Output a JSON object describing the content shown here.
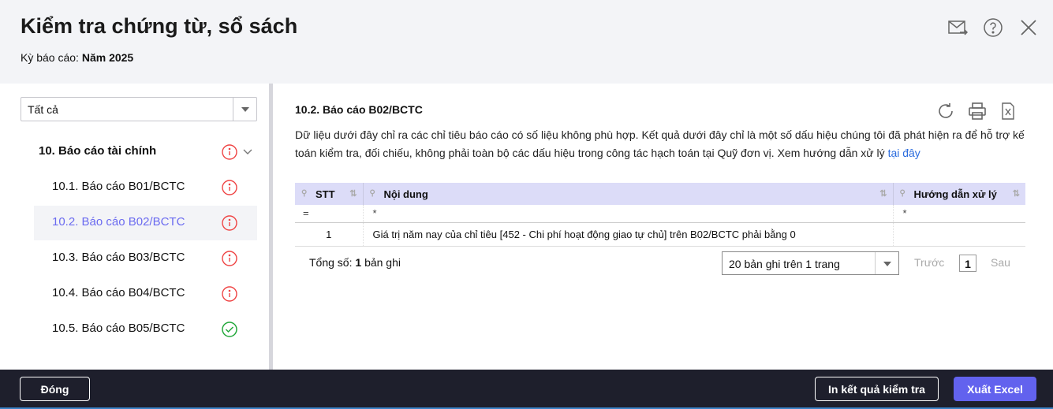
{
  "header": {
    "title": "Kiểm tra chứng từ, sổ sách",
    "period_label": "Kỳ báo cáo:",
    "period_value": "Năm 2025"
  },
  "sidebar": {
    "filter": "Tất cả",
    "group": "10. Báo cáo tài chính",
    "items": [
      {
        "label": "10.1. Báo cáo B01/BCTC",
        "status": "warning"
      },
      {
        "label": "10.2. Báo cáo B02/BCTC",
        "status": "warning"
      },
      {
        "label": "10.3. Báo cáo B03/BCTC",
        "status": "warning"
      },
      {
        "label": "10.4. Báo cáo B04/BCTC",
        "status": "warning"
      },
      {
        "label": "10.5. Báo cáo B05/BCTC",
        "status": "ok"
      }
    ]
  },
  "main": {
    "section_title": "10.2. Báo cáo B02/BCTC",
    "description": "Dữ liệu dưới đây chỉ ra các chỉ tiêu báo cáo có số liệu không phù hợp. Kết quả dưới đây chỉ là một số dấu hiệu chúng tôi đã phát hiện ra để hỗ trợ kế toán kiểm tra, đối chiếu, không phải toàn bộ các dấu hiệu trong công tác hạch toán tại Quỹ đơn vị. Xem hướng dẫn xử lý ",
    "link": "tại đây",
    "columns": [
      "STT",
      "Nội dung",
      "Hướng dẫn xử lý"
    ],
    "filters": [
      "=",
      "*",
      "*"
    ],
    "rows": [
      {
        "stt": "1",
        "content": "Giá trị năm nay của chỉ tiêu [452 - Chi phí hoạt động giao tự chủ] trên B02/BCTC phải bằng 0",
        "guide": ""
      }
    ],
    "total_label": "Tổng số:",
    "total_value": "1",
    "total_suffix": "bản ghi",
    "page_size": "20 bản ghi trên 1 trang",
    "prev": "Trước",
    "page": "1",
    "next": "Sau"
  },
  "footer": {
    "close": "Đóng",
    "print": "In kết quả kiểm tra",
    "export": "Xuất Excel"
  },
  "colors": {
    "accent": "#6262ee",
    "warning": "#ef4444",
    "ok": "#22a83a"
  }
}
